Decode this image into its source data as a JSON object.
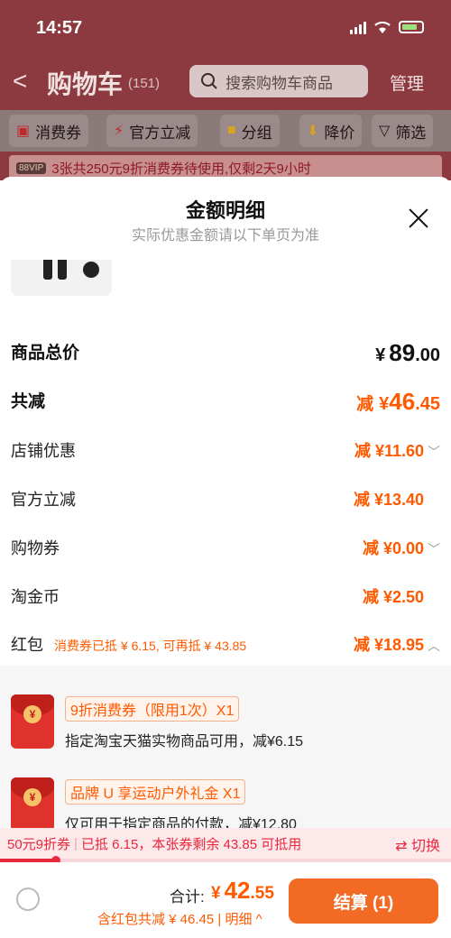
{
  "status_bar": {
    "time": "14:57"
  },
  "cart_header": {
    "back": "<",
    "title": "购物车",
    "count": "(151)",
    "search_placeholder": "搜索购物车商品",
    "manage": "管理"
  },
  "filter_bar": {
    "chips": [
      {
        "icon": "coupon-icon",
        "label": "消费券"
      },
      {
        "icon": "lightning-icon",
        "label": "官方立减"
      },
      {
        "icon": "folder-icon",
        "label": "分组"
      },
      {
        "icon": "price-drop-icon",
        "label": "降价"
      },
      {
        "icon": "filter-icon",
        "label": "筛选"
      }
    ]
  },
  "promo_strip": {
    "vip": "88VIP",
    "text": "3张共250元9折消费券待使用,仅剩2天9小时"
  },
  "sheet": {
    "title": "金额明细",
    "subtitle": "实际优惠金额请以下单页为准",
    "total_price": {
      "label": "商品总价",
      "yen": "¥",
      "int": "89",
      "dec": ".00"
    },
    "total_reduction": {
      "label": "共减",
      "prefix": "减",
      "yen": "¥",
      "int": "46",
      "dec": ".45"
    },
    "lines": [
      {
        "label": "店铺优惠",
        "value": "减 ¥11.60",
        "chevron": "down"
      },
      {
        "label": "官方立减",
        "value": "减 ¥13.40",
        "chevron": ""
      },
      {
        "label": "购物券",
        "value": "减 ¥0.00",
        "chevron": "down"
      },
      {
        "label": "淘金币",
        "value": "减 ¥2.50",
        "chevron": ""
      },
      {
        "label": "红包",
        "note": "消费券已抵 ¥ 6.15, 可再抵 ¥ 43.85",
        "value": "减 ¥18.95",
        "chevron": "up"
      }
    ],
    "coupons": [
      {
        "tag": "9折消费券（限用1次）X1",
        "desc": "指定淘宝天猫实物商品可用，减¥6.15"
      },
      {
        "tag": "品牌 U 享运动户外礼金 X1",
        "desc": "仅可用于指定商品的付款，减¥12.80"
      }
    ]
  },
  "bottom_strip": {
    "coupon_name": "50元9折券",
    "used": "已抵 6.15",
    "remain": "本张券剩余 43.85 可抵用",
    "switch": "⇄ 切换",
    "progress": 0.124
  },
  "checkout": {
    "total_label": "合计:",
    "yen": "¥",
    "total_int": "42",
    "total_dec": ".55",
    "discount_line": "含红包共减 ¥ 46.45 | 明细 ^",
    "button": "结算 (1)"
  }
}
